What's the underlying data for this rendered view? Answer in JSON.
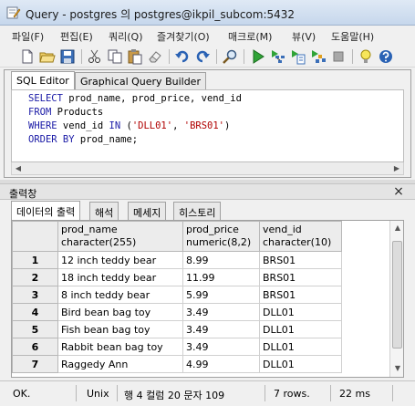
{
  "window": {
    "title": "Query - postgres 의 postgres@ikpil_subcom:5432"
  },
  "menu": [
    "파일(F)",
    "편집(E)",
    "쿼리(Q)",
    "즐겨찾기(O)",
    "매크로(M)",
    "뷰(V)",
    "도움말(H)"
  ],
  "toolbar": {
    "icons": [
      "new-file-icon",
      "open-folder-icon",
      "save-icon",
      "cut-icon",
      "copy-icon",
      "paste-icon",
      "eraser-icon",
      "undo-icon",
      "redo-icon",
      "find-icon",
      "execute-icon",
      "explain-icon",
      "execute-to-file-icon",
      "explain-analyze-icon",
      "cancel-icon",
      "hint-icon",
      "help-icon"
    ]
  },
  "editor": {
    "tabs": [
      "SQL Editor",
      "Graphical Query Builder"
    ],
    "lines": [
      [
        {
          "t": "SELECT",
          "c": "kw"
        },
        {
          "t": " prod_name, prod_price, vend_id",
          "c": "plain"
        }
      ],
      [
        {
          "t": "FROM",
          "c": "kw"
        },
        {
          "t": " Products",
          "c": "plain"
        }
      ],
      [
        {
          "t": "WHERE",
          "c": "kw"
        },
        {
          "t": " vend_id ",
          "c": "plain"
        },
        {
          "t": "IN",
          "c": "kw"
        },
        {
          "t": " (",
          "c": "plain"
        },
        {
          "t": "'DLL01'",
          "c": "str"
        },
        {
          "t": ", ",
          "c": "plain"
        },
        {
          "t": "'BRS01'",
          "c": "str"
        },
        {
          "t": ")",
          "c": "plain"
        }
      ],
      [
        {
          "t": "ORDER BY",
          "c": "kw"
        },
        {
          "t": " prod_name;",
          "c": "plain"
        }
      ]
    ]
  },
  "output": {
    "title": "출력창",
    "close": "×",
    "tabs": [
      "데이터의 출력",
      "해석",
      "메세지",
      "히스토리"
    ]
  },
  "grid": {
    "columns": [
      {
        "name": "prod_name",
        "type": "character(255)"
      },
      {
        "name": "prod_price",
        "type": "numeric(8,2)"
      },
      {
        "name": "vend_id",
        "type": "character(10)"
      }
    ],
    "rows": [
      {
        "n": "1",
        "cells": [
          "12 inch teddy bear",
          "8.99",
          "BRS01"
        ]
      },
      {
        "n": "2",
        "cells": [
          "18 inch teddy bear",
          "11.99",
          "BRS01"
        ]
      },
      {
        "n": "3",
        "cells": [
          "8 inch teddy bear",
          "5.99",
          "BRS01"
        ]
      },
      {
        "n": "4",
        "cells": [
          "Bird bean bag toy",
          "3.49",
          "DLL01"
        ]
      },
      {
        "n": "5",
        "cells": [
          "Fish bean bag toy",
          "3.49",
          "DLL01"
        ]
      },
      {
        "n": "6",
        "cells": [
          "Rabbit bean bag toy",
          "3.49",
          "DLL01"
        ]
      },
      {
        "n": "7",
        "cells": [
          "Raggedy Ann",
          "4.99",
          "DLL01"
        ]
      }
    ]
  },
  "status": {
    "state": "OK.",
    "encoding": "Unix",
    "position": "행 4 컬럼 20 문자 109",
    "rows": "7 rows.",
    "time": "22 ms"
  }
}
